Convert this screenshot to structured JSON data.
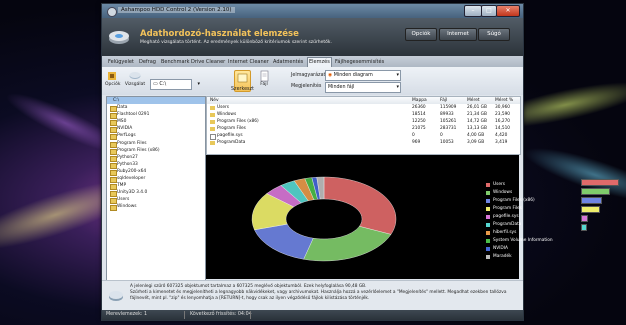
{
  "window": {
    "title": "Ashampoo HDD Control 2 (Version 2.10)",
    "minimize_icon": "minimize-icon",
    "maximize_icon": "maximize-icon",
    "close_icon": "close-icon"
  },
  "header": {
    "title": "Adathordozó-használat elemzése",
    "subtitle": "Megható vizsgálata történt. Az eredmények különböző kritériumok szerint szűrhetők.",
    "buttons": {
      "options": "Opciók",
      "internet": "Internet",
      "help": "Súgó"
    }
  },
  "tabs": [
    {
      "label": "Felügyelet"
    },
    {
      "label": "Defrag"
    },
    {
      "label": "Benchmark"
    },
    {
      "label": "Drive Cleaner"
    },
    {
      "label": "Internet Cleaner"
    },
    {
      "label": "Adatmentés"
    },
    {
      "label": "Elemzés"
    },
    {
      "label": "Fájlhegesemmisítés"
    }
  ],
  "ribbon": {
    "options": "Opciók",
    "scan": "Vizsgálat",
    "drive": "C:\\",
    "edit": "Szerkeszt",
    "files": "Fájl",
    "display_label": "Jelmagyarázat",
    "display_value": "Minden diagram",
    "show_label": "Megjelenítés",
    "show_value": "Minden fájl"
  },
  "tree": {
    "root": "C:\\",
    "items": [
      "Data",
      "Flashtool 0291",
      "MS0",
      "NVIDIA",
      "PerfLogs",
      "Program Files",
      "Program Files (x86)",
      "Python27",
      "Python33",
      "Ruby200-x64",
      "sqldeveloper",
      "TMP",
      "Unity3D 3.4.0",
      "Users",
      "Windows"
    ]
  },
  "list": {
    "columns": {
      "name": "Név",
      "folders": "Mappa",
      "files": "Fájl",
      "size": "Méret",
      "percent": "Méret %"
    },
    "rows": [
      {
        "name": "Users",
        "folders": "26360",
        "files": "115909",
        "size": "26,01 GB",
        "percent": "30,960"
      },
      {
        "name": "Windows",
        "folders": "18514",
        "files": "89933",
        "size": "21,34 GB",
        "percent": "23,590"
      },
      {
        "name": "Program Files (x86)",
        "folders": "12250",
        "files": "105261",
        "size": "14,72 GB",
        "percent": "16,270"
      },
      {
        "name": "Program Files",
        "folders": "21075",
        "files": "283731",
        "size": "13,13 GB",
        "percent": "14,510"
      },
      {
        "name": "pagefile.sys",
        "folders": "0",
        "files": "0",
        "size": "4,00 GB",
        "percent": "4,420"
      },
      {
        "name": "ProgramData",
        "folders": "969",
        "files": "10053",
        "size": "3,09 GB",
        "percent": "3,419"
      }
    ]
  },
  "chart_data": {
    "type": "pie",
    "categories": [
      "Users",
      "Windows",
      "Program Files (x86)",
      "Program Files",
      "pagefile.sys",
      "ProgramData",
      "hiberfil.sys",
      "System Volume Information",
      "NVIDIA",
      "Maradék"
    ],
    "colors": [
      "#e06a6a",
      "#7fcb6b",
      "#6e84e3",
      "#eeee6c",
      "#d777d6",
      "#56d6d0",
      "#e89a4a",
      "#4bbd4a",
      "#4668d8",
      "#bdbdbd"
    ],
    "values": [
      30.96,
      23.59,
      16.27,
      14.51,
      4.42,
      3.42,
      2.5,
      1.6,
      1.1,
      1.6
    ]
  },
  "info": {
    "line1": "A jelenlegi szűrő 607325 objektumot tartalmaz a 607325 meglévő objektumból. Ezek helyfoglalása 90,48 GB.",
    "line2": "Szűrheti a kimenetet és megjelenítheti a legnagyobb näkvidékeket, vagy archivumokat. Használja hozzá a vezérlőelemet a \"Megjelenítés\" mellett. Megadhat ezekben tallózva",
    "line3": "fájlnevét, mint pl. \"zip\" és lenyomhatja a [RETURN]-t, hogy csak az ilyen végződésű fájlok kilistázása történjék."
  },
  "status": {
    "version": "Merevlemezek: 1",
    "next": "Következő frissítés: 04:04"
  }
}
